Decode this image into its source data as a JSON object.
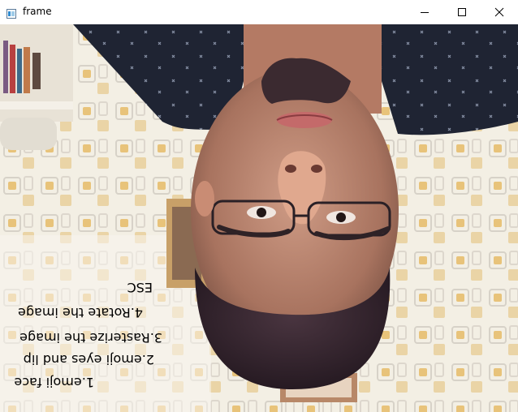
{
  "window": {
    "title": "frame",
    "icon": "opencv-window-icon",
    "controls": {
      "minimize_icon": "minimize-icon",
      "maximize_icon": "maximize-icon",
      "close_icon": "close-icon"
    }
  },
  "frame": {
    "content": "webcam-feed-upside-down",
    "menu": {
      "items": [
        "1.emoji face",
        "2.emoji eyes and lip",
        "3.Rasterize the image",
        "4.Rotate the image",
        "ESC"
      ]
    }
  }
}
